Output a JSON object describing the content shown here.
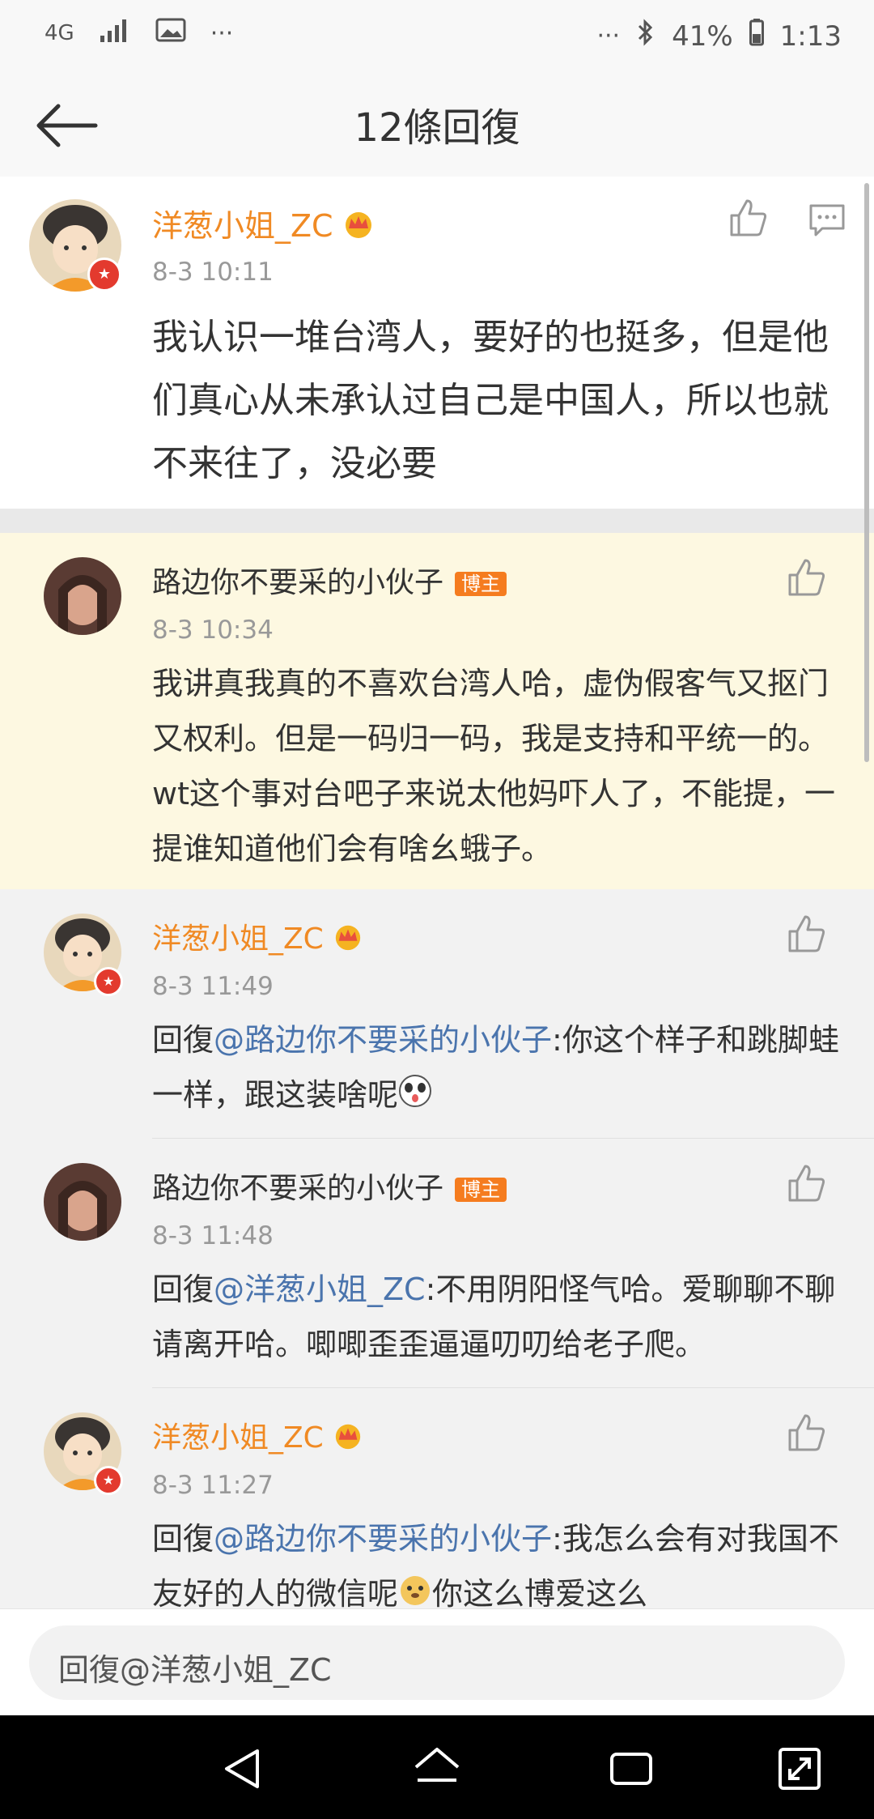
{
  "status_bar": {
    "network": "4G",
    "more": "···",
    "more_right": "···",
    "battery": "41%",
    "time": "1:13"
  },
  "header": {
    "title": "12條回復"
  },
  "top_comment": {
    "user": "洋葱小姐_ZC",
    "time": "8-3 10:11",
    "text": "我认识一堆台湾人，要好的也挺多，但是他们真心从未承认过自己是中国人，所以也就不来往了，没必要"
  },
  "replies": [
    {
      "user": "路边你不要采的小伙子",
      "badge": "博主",
      "time": "8-3 10:34",
      "text": "我讲真我真的不喜欢台湾人哈，虚伪假客气又抠门又权利。但是一码归一码，我是支持和平统一的。wt这个事对台吧子来说太他妈吓人了，不能提，一提谁知道他们会有啥幺蛾子。"
    },
    {
      "user": "洋葱小姐_ZC",
      "time": "8-3 11:49",
      "reply_prefix": "回復",
      "mention": "@路边你不要采的小伙子",
      "text": ":你这个样子和跳脚蛙一样，跟这装啥呢"
    },
    {
      "user": "路边你不要采的小伙子",
      "badge": "博主",
      "time": "8-3 11:48",
      "reply_prefix": "回復",
      "mention": "@洋葱小姐_ZC",
      "text": ":不用阴阳怪气哈。爱聊聊不聊请离开哈。唧唧歪歪逼逼叨叨给老子爬。"
    },
    {
      "user": "洋葱小姐_ZC",
      "time": "8-3 11:27",
      "reply_prefix": "回復",
      "mention": "@路边你不要采的小伙子",
      "text": ":我怎么会有对我国不友好的人的微信呢",
      "text_after_emoji": "你这么博爱这么"
    }
  ],
  "input": {
    "placeholder": "回復@洋葱小姐_ZC"
  },
  "colors": {
    "orange_name": "#f08a24",
    "mention": "#4a74ad",
    "highlight_bg": "#fdf8e1",
    "blogger_badge": "#f57c1f"
  }
}
